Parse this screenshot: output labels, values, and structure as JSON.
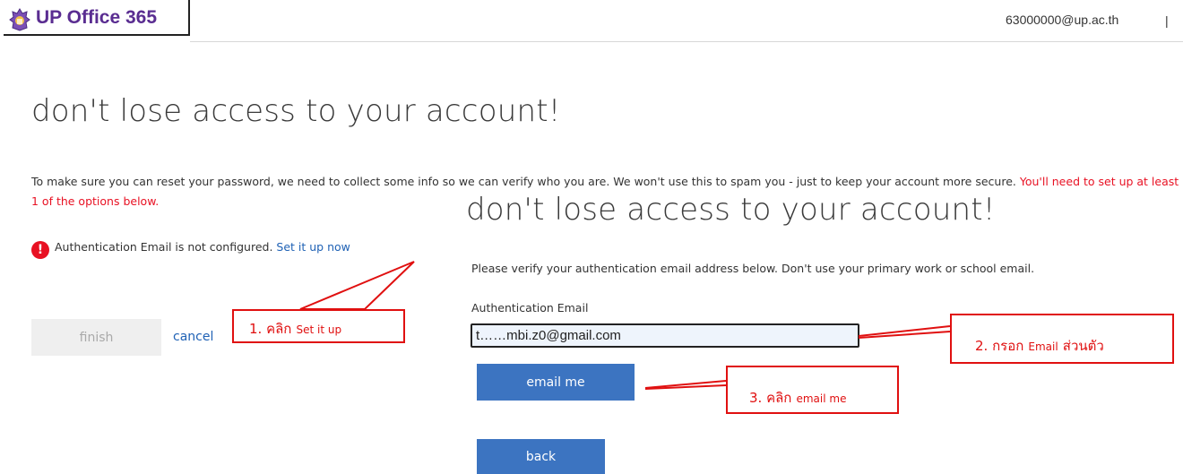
{
  "header": {
    "app_name": "UP Office 365",
    "logo_icon": "university-seal-icon",
    "user_email": "63000000@up.ac.th",
    "divider": "|"
  },
  "page": {
    "heading": "don't lose access to your account!",
    "intro_text": "To make sure you can reset your password, we need to collect some info so we can verify who you are. We won't use this to spam you - just to keep your account more secure. ",
    "intro_warning": "You'll need to set up at least 1 of the options below.",
    "auth_status": {
      "icon": "alert-icon",
      "icon_glyph": "!",
      "text": "Authentication Email is not configured. ",
      "link": "Set it up now"
    },
    "finish_label": "finish",
    "cancel_label": "cancel"
  },
  "verify_panel": {
    "heading": "don't lose access to your account!",
    "instruction": "Please verify your authentication email address below. Don't use your primary work or school email.",
    "field_label": "Authentication Email",
    "email_value": "t……mbi.z0@gmail.com",
    "email_me_label": "email me",
    "back_label": "back"
  },
  "annotations": {
    "step1": {
      "main": "1. คลิก",
      "detail": "Set it up"
    },
    "step2": {
      "main": "2. กรอก",
      "detail": "Email",
      "main_suffix": "ส่วนตัว"
    },
    "step3": {
      "main": "3. คลิก",
      "detail": "email me"
    },
    "color": "#e01010"
  },
  "colors": {
    "brand": "#5a2d91",
    "link": "#2062b5",
    "primary_button": "#3c74c1",
    "warning": "#e81123"
  }
}
